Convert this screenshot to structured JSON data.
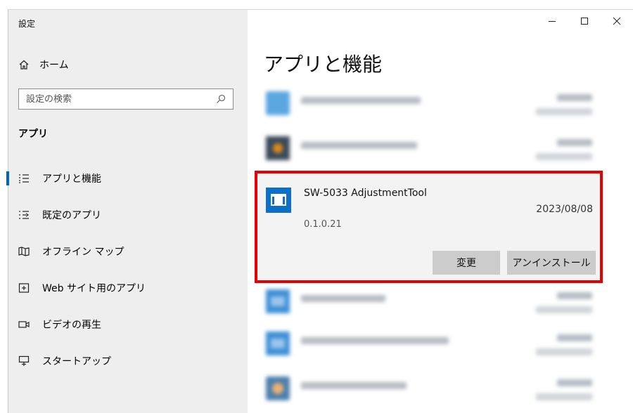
{
  "window": {
    "title": "設定"
  },
  "sidebar": {
    "home_label": "ホーム",
    "search_placeholder": "設定の検索",
    "section_title": "アプリ",
    "items": [
      {
        "label": "アプリと機能",
        "icon": "list-icon",
        "active": true
      },
      {
        "label": "既定のアプリ",
        "icon": "default-apps-icon"
      },
      {
        "label": "オフライン マップ",
        "icon": "map-icon"
      },
      {
        "label": "Web サイト用のアプリ",
        "icon": "web-app-icon"
      },
      {
        "label": "ビデオの再生",
        "icon": "video-icon"
      },
      {
        "label": "スタートアップ",
        "icon": "startup-icon"
      }
    ]
  },
  "main": {
    "title": "アプリと機能",
    "selected_app": {
      "name": "SW-5033 AdjustmentTool",
      "date": "2023/08/08",
      "version": "0.1.0.21",
      "modify_label": "変更",
      "uninstall_label": "アンインストール"
    }
  },
  "colors": {
    "accent": "#0067c0",
    "highlight_border": "#e60000",
    "sidebar_bg": "#eeeeee"
  }
}
